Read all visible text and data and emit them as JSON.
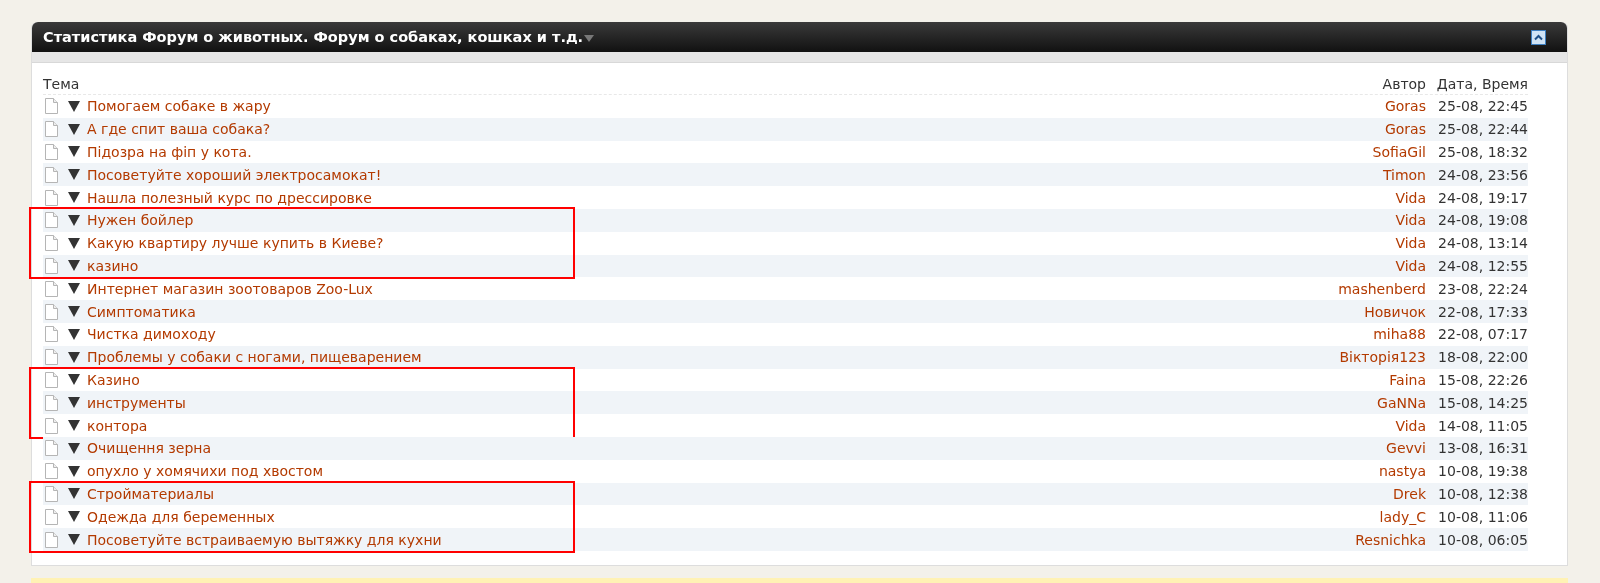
{
  "panel": {
    "title": "Статистика Форум о животных. Форум о собаках, кошках и т.д."
  },
  "columns": {
    "topic": "Тема",
    "author": "Автор",
    "date": "Дата, Время"
  },
  "topic_groups": [
    {
      "marked": false,
      "rows": [
        {
          "title": "Помогаем собаке в жару",
          "author": "Goras",
          "date": "25-08, 22:45"
        },
        {
          "title": "А где спит ваша собака?",
          "author": "Goras",
          "date": "25-08, 22:44"
        },
        {
          "title": "Підозра на фіп у кота.",
          "author": "SofiaGil",
          "date": "25-08, 18:32"
        },
        {
          "title": "Посоветуйте хороший электросамокат!",
          "author": "Timon",
          "date": "24-08, 23:56"
        },
        {
          "title": "Нашла полезный курс по дрессировке",
          "author": "Vida",
          "date": "24-08, 19:17"
        }
      ]
    },
    {
      "marked": true,
      "rows": [
        {
          "title": "Нужен бойлер",
          "author": "Vida",
          "date": "24-08, 19:08"
        },
        {
          "title": "Какую квартиру лучше купить в Киеве?",
          "author": "Vida",
          "date": "24-08, 13:14"
        },
        {
          "title": "казино",
          "author": "Vida",
          "date": "24-08, 12:55"
        }
      ]
    },
    {
      "marked": false,
      "rows": [
        {
          "title": "Интернет магазин зоотоваров Zoo-Lux",
          "author": "mashenberd",
          "date": "23-08, 22:24"
        },
        {
          "title": "Симптоматика",
          "author": "Новичок",
          "date": "22-08, 17:33"
        },
        {
          "title": "Чистка димоходу",
          "author": "miha88",
          "date": "22-08, 07:17"
        },
        {
          "title": "Проблемы у собаки с ногами, пищеварением",
          "author": "Вікторія123",
          "date": "18-08, 22:00"
        }
      ]
    },
    {
      "marked": true,
      "rows": [
        {
          "title": "Казино",
          "author": "Faina",
          "date": "15-08, 22:26"
        },
        {
          "title": "инструменты",
          "author": "GaNNa",
          "date": "15-08, 14:25"
        },
        {
          "title": "контора",
          "author": "Vida",
          "date": "14-08, 11:05"
        }
      ]
    },
    {
      "marked": false,
      "rows": [
        {
          "title": "Очищення зерна",
          "author": "Gevvi",
          "date": "13-08, 16:31"
        },
        {
          "title": "опухло у хомячихи под хвостом",
          "author": "nastya",
          "date": "10-08, 19:38"
        }
      ]
    },
    {
      "marked": true,
      "rows": [
        {
          "title": "Стройматериалы",
          "author": "Drek",
          "date": "10-08, 12:38"
        },
        {
          "title": "Одежда для беременных",
          "author": "lady_C",
          "date": "10-08, 11:06"
        },
        {
          "title": "Посоветуйте встраиваемую вытяжку для кухни",
          "author": "Resnichka",
          "date": "10-08, 06:05"
        }
      ]
    }
  ]
}
